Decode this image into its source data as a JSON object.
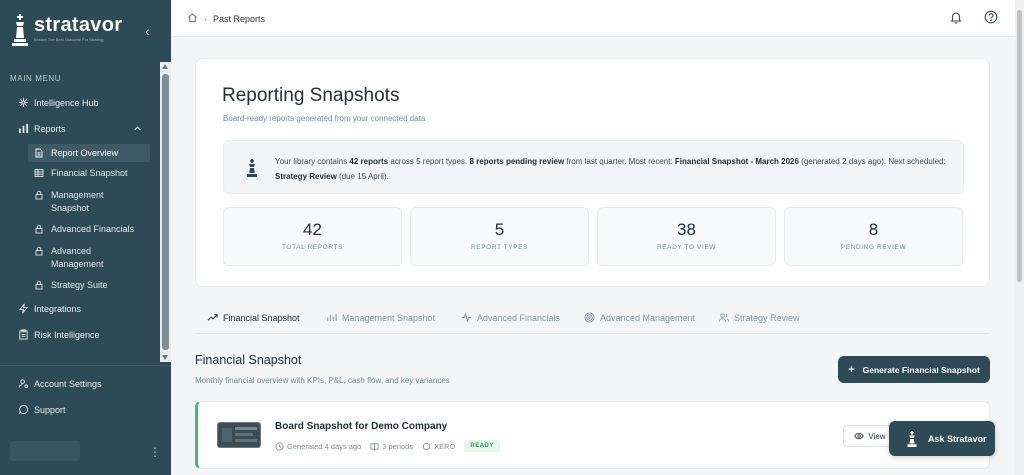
{
  "brand": {
    "name": "stratavor",
    "tagline": "Ensure The Best Outcome For Strategy"
  },
  "sidebar": {
    "menu_title": "MAIN MENU",
    "items": [
      {
        "label": "Intelligence Hub",
        "icon": "intelligence-hub-icon"
      },
      {
        "label": "Reports",
        "icon": "bar-chart-icon",
        "expanded": true
      },
      {
        "label": "Integrations",
        "icon": "lightning-icon"
      },
      {
        "label": "Risk Intelligence",
        "icon": "clipboard-icon"
      }
    ],
    "report_items": [
      {
        "label": "Report Overview",
        "icon": "document-icon",
        "active": true
      },
      {
        "label": "Financial Snapshot",
        "icon": "table-icon"
      },
      {
        "label": "Management Snapshot",
        "icon": "lock-icon"
      },
      {
        "label": "Advanced Financials",
        "icon": "lock-icon"
      },
      {
        "label": "Advanced Management",
        "icon": "lock-icon"
      },
      {
        "label": "Strategy Suite",
        "icon": "lock-icon"
      }
    ],
    "footer_items": [
      {
        "label": "Account Settings",
        "icon": "user-settings-icon"
      },
      {
        "label": "Support",
        "icon": "chat-icon"
      }
    ]
  },
  "topbar": {
    "breadcrumb": "Past Reports"
  },
  "hero": {
    "title": "Reporting Snapshots",
    "subtitle": "Board-ready reports generated from your connected data",
    "info": {
      "p1": "Your library contains ",
      "total": "42 reports",
      "p2": " across 5 report types. ",
      "pending": "8 reports pending review",
      "p3": " from last quarter. Most recent: ",
      "recent": "Financial Snapshot - March 2026",
      "p4": " (generated 2 days ago). Next scheduled: ",
      "next": "Strategy Review",
      "p5": " (due 15 April)."
    },
    "stats": [
      {
        "value": "42",
        "label": "TOTAL REPORTS"
      },
      {
        "value": "5",
        "label": "REPORT TYPES"
      },
      {
        "value": "38",
        "label": "READY TO VIEW"
      },
      {
        "value": "8",
        "label": "PENDING REVIEW"
      }
    ]
  },
  "tabs": [
    {
      "label": "Financial Snapshot",
      "icon": "trend-icon",
      "active": true
    },
    {
      "label": "Management Snapshot",
      "icon": "bars-icon"
    },
    {
      "label": "Advanced Financials",
      "icon": "activity-icon"
    },
    {
      "label": "Advanced Management",
      "icon": "target-icon"
    },
    {
      "label": "Strategy Review",
      "icon": "users-icon"
    }
  ],
  "section": {
    "title": "Financial Snapshot",
    "subtitle": "Monthly financial overview with KPIs, P&L, cash flow, and key variances",
    "generate_label": "Generate Financial Snapshot"
  },
  "report_card": {
    "title": "Board Snapshot for Demo Company",
    "generated": "Generated 4 days ago",
    "periods": "3 periods",
    "source": "XERO",
    "status": "READY",
    "view_label": "View"
  },
  "ask_label": "Ask Stratavor",
  "colors": {
    "sidebar": "#2f4a57",
    "accent_green": "#3fbf6a",
    "ready_badge_bg": "#e3f6e9"
  }
}
